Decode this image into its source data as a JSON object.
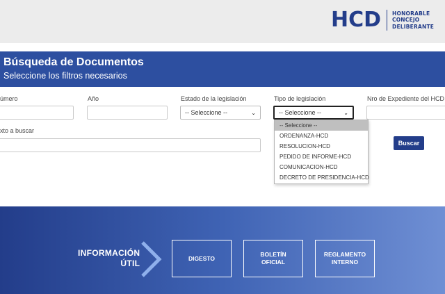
{
  "header": {
    "logo_abbr": "HCD",
    "logo_line1": "HONORABLE",
    "logo_line2": "CONCEJO",
    "logo_line3": "DELIBERANTE"
  },
  "banner": {
    "title": "Búsqueda de Documentos",
    "subtitle": "Seleccione los filtros necesarios"
  },
  "filters": {
    "numero_label": "úmero",
    "numero_value": "",
    "anio_label": "Año",
    "anio_value": "",
    "estado_label": "Estado de la legislación",
    "estado_selected": "-- Seleccione --",
    "tipo_label": "Tipo de legislación",
    "tipo_selected": "-- Seleccione --",
    "expediente_label": "Nro de Expediente del HCD",
    "expediente_value": "",
    "texto_label": "xto a buscar",
    "texto_value": ""
  },
  "tipo_options": [
    "-- Seleccione --",
    "ORDENANZA-HCD",
    "RESOLUCION-HCD",
    "PEDIDO DE INFORME-HCD",
    "COMUNICACION-HCD",
    "DECRETO DE PRESIDENCIA-HCD"
  ],
  "search_button": "Buscar",
  "footer": {
    "info_line1": "INFORMACIÓN",
    "info_line2": "ÚTIL",
    "boxes": [
      {
        "line1": "DIGESTO",
        "line2": ""
      },
      {
        "line1": "BOLETÍN",
        "line2": "OFICIAL"
      },
      {
        "line1": "REGLAMENTO",
        "line2": "INTERNO"
      }
    ]
  },
  "colors": {
    "brand_blue": "#233d8a",
    "banner_blue": "#2d4fa0"
  }
}
